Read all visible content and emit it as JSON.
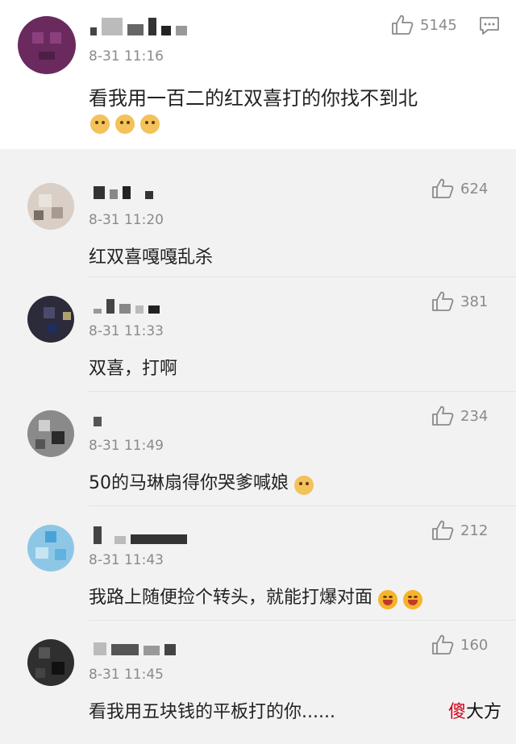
{
  "main": {
    "time": "8-31 11:16",
    "likes": "5145",
    "text": "看我用一百二的红双喜打的你找不到北",
    "emojis": [
      "doge-emoji",
      "doge-emoji",
      "doge-emoji"
    ]
  },
  "replies": [
    {
      "time": "8-31 11:20",
      "likes": "624",
      "text": "红双喜嘎嘎乱杀"
    },
    {
      "time": "8-31 11:33",
      "likes": "381",
      "text": "双喜，打啊"
    },
    {
      "time": "8-31 11:49",
      "likes": "234",
      "text": "50的马琳扇得你哭爹喊娘"
    },
    {
      "time": "8-31 11:43",
      "likes": "212",
      "text": "我路上随便捡个转头，就能打爆对面"
    },
    {
      "time": "8-31 11:45",
      "likes": "160",
      "text": "看我用五块钱的平板打的你......"
    }
  ],
  "watermark": {
    "red_char": "傻",
    "rest": "大方"
  },
  "colors": {
    "accent_red": "#d0021b",
    "meta_gray": "#8a8a8a"
  }
}
